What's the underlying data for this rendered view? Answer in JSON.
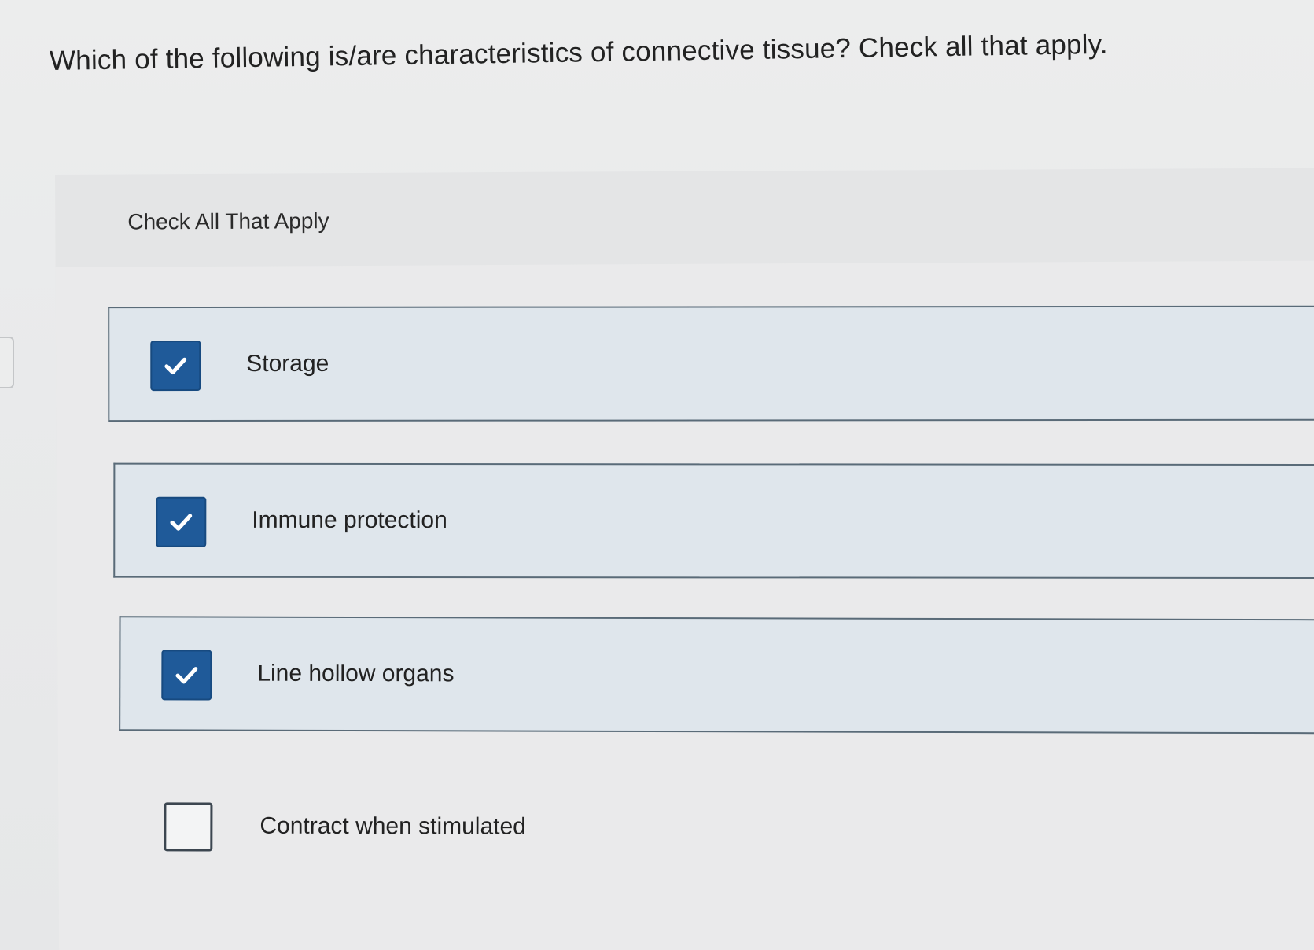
{
  "question": {
    "text": "Which of the following is/are characteristics of connective tissue? Check all that apply."
  },
  "instruction": {
    "label": "Check All That Apply"
  },
  "options": [
    {
      "label": "Storage",
      "checked": true
    },
    {
      "label": "Immune protection",
      "checked": true
    },
    {
      "label": "Line hollow organs",
      "checked": true
    },
    {
      "label": "Contract when stimulated",
      "checked": false
    }
  ],
  "colors": {
    "checked_fill": "#1f5a99",
    "option_selected_bg": "#dfe6ec",
    "option_border": "#5a6b78"
  },
  "icons": {
    "checked": "checkmark-icon"
  }
}
